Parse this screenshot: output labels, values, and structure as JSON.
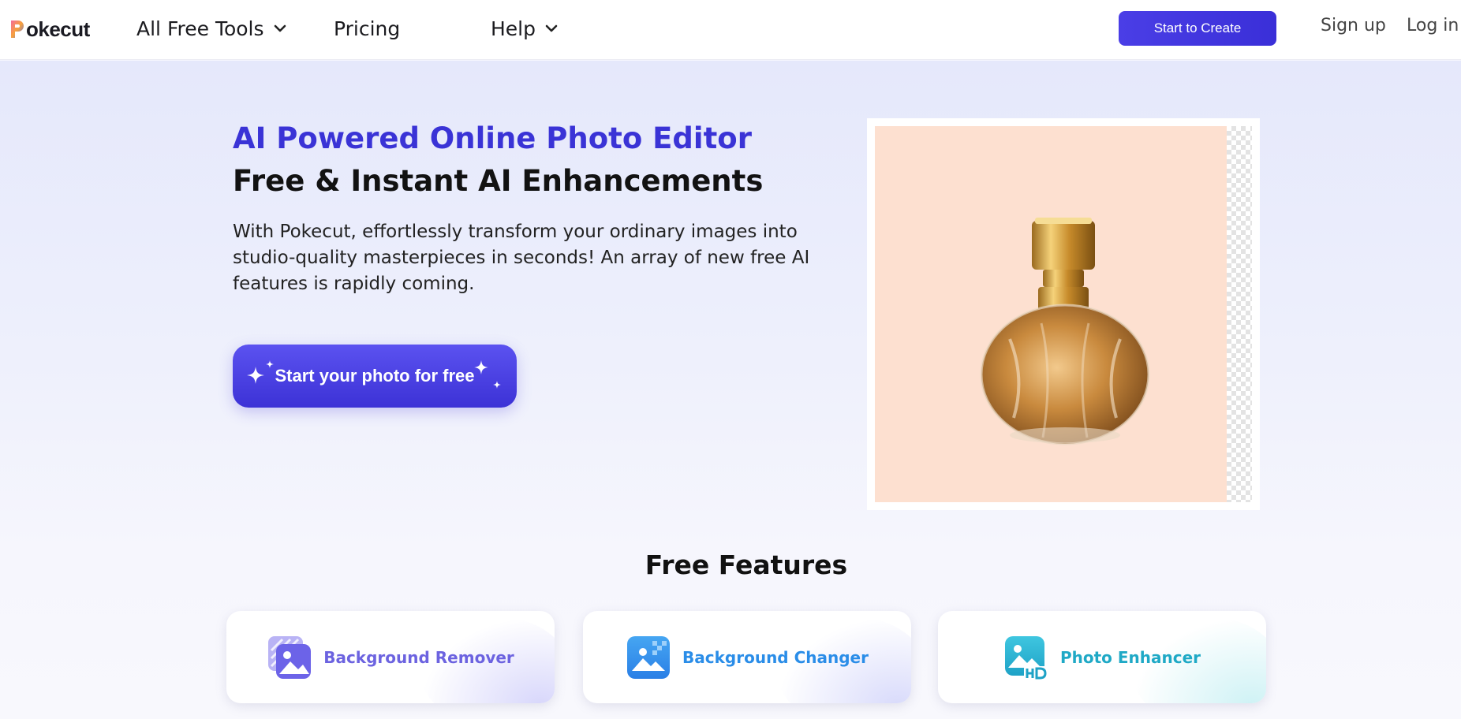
{
  "header": {
    "logo_text": "okecut",
    "nav": {
      "tools_label": "All Free Tools",
      "pricing_label": "Pricing",
      "help_label": "Help"
    },
    "start_create_label": "Start to Create",
    "signup_label": "Sign up",
    "login_label": "Log in"
  },
  "hero": {
    "title": "AI Powered Online Photo Editor",
    "subtitle": "Free & Instant AI Enhancements",
    "description": "With Pokecut, effortlessly transform your ordinary images into studio-quality masterpieces in seconds! An array of new free AI features is rapidly coming.",
    "cta_label": "Start your photo for free"
  },
  "features": {
    "title": "Free Features",
    "items": [
      {
        "label": "Background Remover",
        "icon": "background-remover-icon"
      },
      {
        "label": "Background Changer",
        "icon": "background-changer-icon"
      },
      {
        "label": "Photo Enhancer",
        "icon": "photo-enhancer-icon"
      }
    ]
  },
  "colors": {
    "accent": "#3a33d6",
    "cta_button": "#4a3ee6",
    "preview_background": "#fde0d0"
  }
}
